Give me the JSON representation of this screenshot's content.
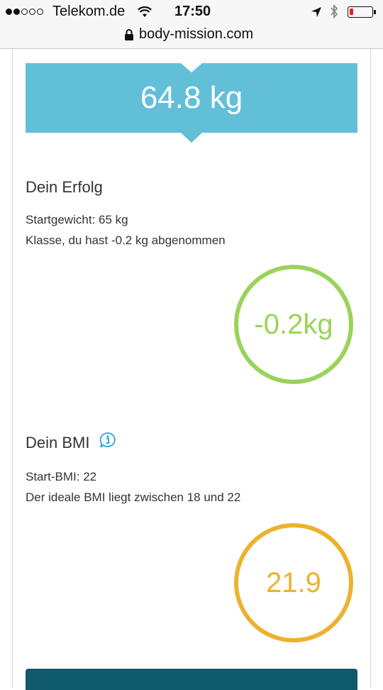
{
  "status_bar": {
    "carrier": "Telekom.de",
    "time": "17:50",
    "signal_bars_filled": 2,
    "signal_bars_total": 5
  },
  "browser": {
    "url": "body-mission.com"
  },
  "weight_banner": {
    "value": "64.8 kg",
    "color": "#62bfd8"
  },
  "success": {
    "title": "Dein Erfolg",
    "start_weight": "Startgewicht: 65 kg",
    "message": "Klasse, du hast -0.2 kg abgenommen",
    "circle_value": "-0.2kg",
    "color": "#9ad35a"
  },
  "bmi": {
    "title": "Dein BMI",
    "info_icon": "info-icon",
    "start_bmi": "Start-BMI: 22",
    "ideal_range": "Der ideale BMI liegt zwischen 18 und 22",
    "circle_value": "21.9",
    "color": "#ecb22e"
  },
  "footer_button_color": "#0f5a6a"
}
